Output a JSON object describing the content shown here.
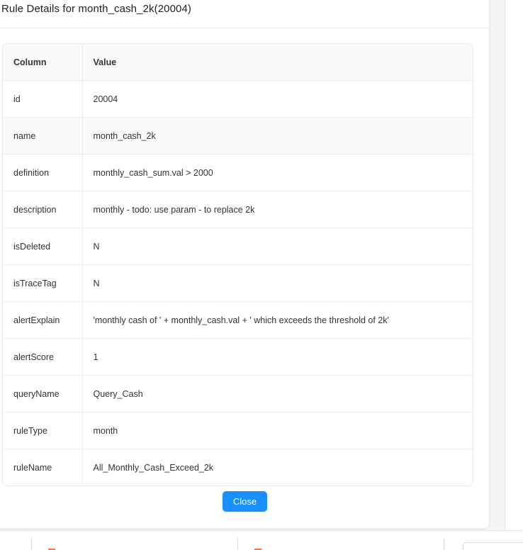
{
  "modal": {
    "title": "Rule Details for month_cash_2k(20004)",
    "close_label": "Close"
  },
  "table": {
    "headers": [
      "Column",
      "Value"
    ],
    "rows": [
      {
        "column": "id",
        "value": "20004"
      },
      {
        "column": "name",
        "value": "month_cash_2k"
      },
      {
        "column": "definition",
        "value": "monthly_cash_sum.val > 2000"
      },
      {
        "column": "description",
        "value": "monthly - todo: use param - to replace 2k"
      },
      {
        "column": "isDeleted",
        "value": "N"
      },
      {
        "column": "isTraceTag",
        "value": "N"
      },
      {
        "column": "alertExplain",
        "value": "'monthly cash of ' + monthly_cash.val + ' which exceeds the threshold of 2k'"
      },
      {
        "column": "alertScore",
        "value": "1"
      },
      {
        "column": "queryName",
        "value": "Query_Cash"
      },
      {
        "column": "ruleType",
        "value": "month"
      },
      {
        "column": "ruleName",
        "value": "All_Monthly_Cash_Exceed_2k"
      }
    ]
  },
  "colors": {
    "primary": "#1890ff",
    "header_bg": "#fafafa",
    "accent_orange": "#f5754a"
  }
}
